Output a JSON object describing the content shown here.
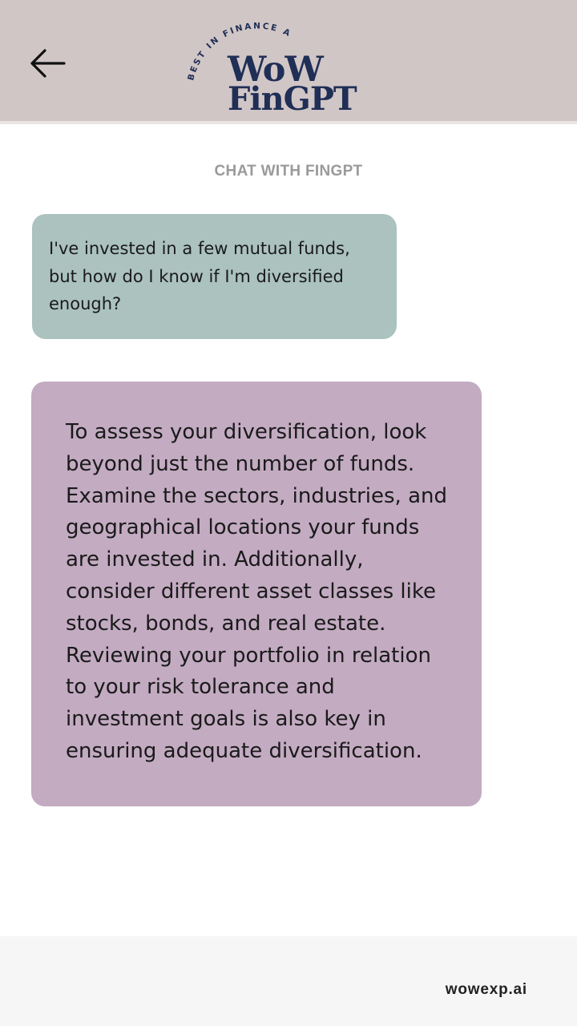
{
  "header": {
    "back_icon": "arrow-left-icon",
    "logo": {
      "tagline": "BEST IN FINANCE ADVISORY",
      "line1": "WoW",
      "line2": "FinGPT",
      "color": "#1f2f56"
    },
    "background": "#d1c6c6"
  },
  "chat": {
    "title": "CHAT WITH FINGPT",
    "messages": [
      {
        "role": "user",
        "text": "I've invested in a few mutual funds, but how do I know if I'm diversified enough?",
        "color": "#abc2bf"
      },
      {
        "role": "assistant",
        "text": "To assess your diversification, look beyond just the number of funds. Examine the sectors, industries, and geographical locations your funds are invested in. Additionally, consider different asset classes like stocks, bonds, and real estate. Reviewing your portfolio in relation to your risk tolerance and investment goals is also key in ensuring adequate diversification.",
        "color": "#c3abc2"
      }
    ]
  },
  "footer": {
    "brand": "wowexp.ai"
  }
}
